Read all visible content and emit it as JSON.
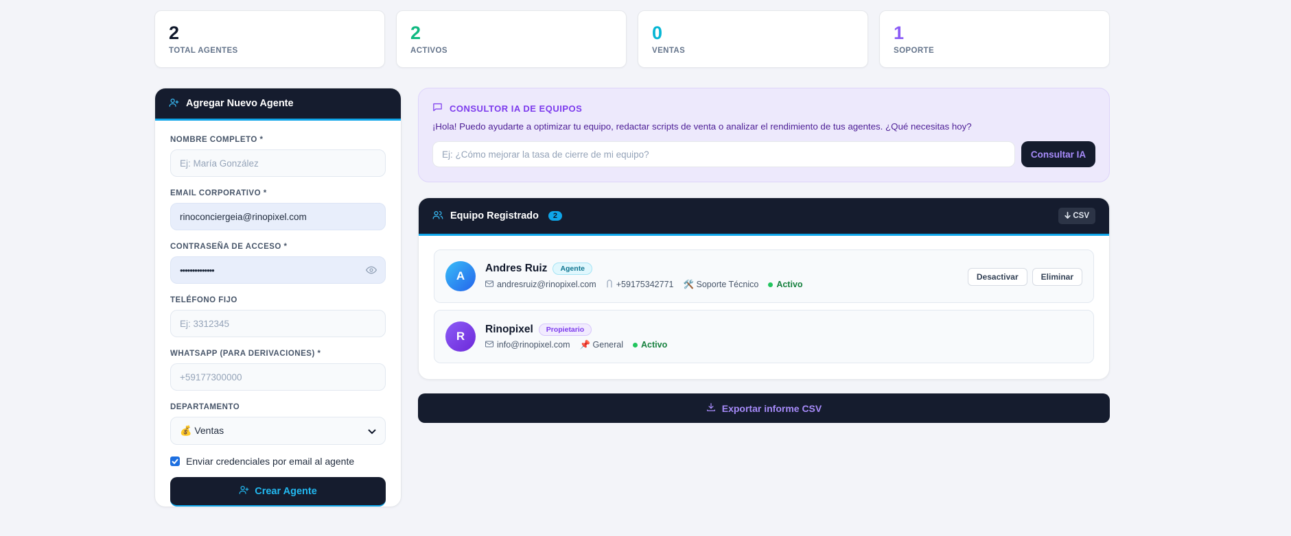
{
  "stats": [
    {
      "value": "2",
      "label": "TOTAL AGENTES",
      "color": "#0f172a"
    },
    {
      "value": "2",
      "label": "ACTIVOS",
      "color": "#10b981"
    },
    {
      "value": "0",
      "label": "VENTAS",
      "color": "#06b6d4"
    },
    {
      "value": "1",
      "label": "SOPORTE",
      "color": "#8b5cf6"
    }
  ],
  "form": {
    "title": "Agregar Nuevo Agente",
    "name_label": "NOMBRE COMPLETO *",
    "name_placeholder": "Ej: María González",
    "email_label": "EMAIL CORPORATIVO *",
    "email_value": "rinoconciergeia@rinopixel.com",
    "password_label": "CONTRASEÑA DE ACCESO *",
    "password_value": "••••••••••••••",
    "phone_label": "TELÉFONO FIJO",
    "phone_placeholder": "Ej: 3312345",
    "whatsapp_label": "WHATSAPP (PARA DERIVACIONES) *",
    "whatsapp_placeholder": "+59177300000",
    "department_label": "DEPARTAMENTO",
    "department_value": "💰 Ventas",
    "send_credentials_label": "Enviar credenciales por email al agente",
    "send_credentials_checked": true,
    "submit_label": "Crear Agente"
  },
  "ai": {
    "title": "CONSULTOR IA DE EQUIPOS",
    "message": "¡Hola! Puedo ayudarte a optimizar tu equipo, redactar scripts de venta o analizar el rendimiento de tus agentes. ¿Qué necesitas hoy?",
    "input_placeholder": "Ej: ¿Cómo mejorar la tasa de cierre de mi equipo?",
    "button_label": "Consultar IA"
  },
  "team": {
    "title": "Equipo Registrado",
    "count": "2",
    "csv_label": "CSV",
    "members": [
      {
        "initial": "A",
        "name": "Andres Ruiz",
        "role": "Agente",
        "email": "andresruiz@rinopixel.com",
        "phone": "+59175342771",
        "department": "🛠️ Soporte Técnico",
        "status": "Activo",
        "deactivate_label": "Desactivar",
        "delete_label": "Eliminar"
      },
      {
        "initial": "R",
        "name": "Rinopixel",
        "role": "Propietario",
        "email": "info@rinopixel.com",
        "department": "📌 General",
        "status": "Activo"
      }
    ]
  },
  "export_label": "Exportar informe CSV",
  "colors": {
    "navy": "#151c2e",
    "accent_cyan": "#0ea5e9",
    "accent_purple": "#8b5cf6",
    "active_green": "#22c55e"
  }
}
